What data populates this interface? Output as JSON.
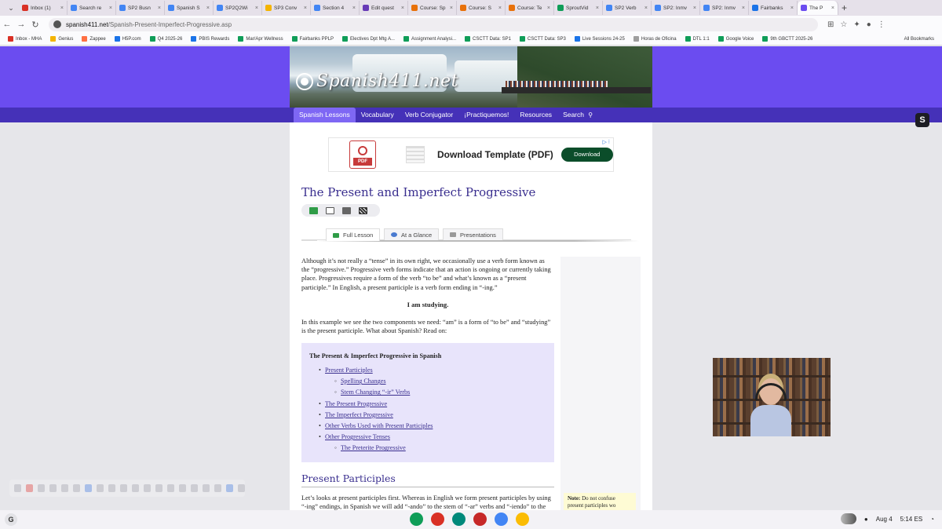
{
  "browser": {
    "tabs": [
      {
        "label": "Inbox (1)",
        "color": "#d93025"
      },
      {
        "label": "Search re",
        "color": "#4285f4"
      },
      {
        "label": "SP2 Busn",
        "color": "#4285f4"
      },
      {
        "label": "Spanish S",
        "color": "#4285f4"
      },
      {
        "label": "SP2Q2Wi",
        "color": "#4285f4"
      },
      {
        "label": "SP3 Conv",
        "color": "#f4b400"
      },
      {
        "label": "Section 4",
        "color": "#4285f4"
      },
      {
        "label": "Edit quest",
        "color": "#673ab7"
      },
      {
        "label": "Course: Sp",
        "color": "#e8710a"
      },
      {
        "label": "Course: S",
        "color": "#e8710a"
      },
      {
        "label": "Course: Te",
        "color": "#e8710a"
      },
      {
        "label": "SproutVid",
        "color": "#0f9d58"
      },
      {
        "label": "SP2 Verb",
        "color": "#4285f4"
      },
      {
        "label": "SP2: Inmv",
        "color": "#4285f4"
      },
      {
        "label": "SP2: Inmv",
        "color": "#4285f4"
      },
      {
        "label": "Fairbanks",
        "color": "#1a73e8"
      },
      {
        "label": "The P",
        "color": "#6b4cf0",
        "active": true
      }
    ],
    "url_host": "spanish411.net",
    "url_path": "/Spanish-Present-Imperfect-Progressive.asp",
    "bookmarks": [
      {
        "label": "Inbox - MHA",
        "color": "#d93025"
      },
      {
        "label": "Genius",
        "color": "#f4b400"
      },
      {
        "label": "Zappee",
        "color": "#ff7043"
      },
      {
        "label": "H5P.com",
        "color": "#1a73e8"
      },
      {
        "label": "Q4 2025-26",
        "color": "#0f9d58"
      },
      {
        "label": "PBIS Rewards",
        "color": "#1a73e8"
      },
      {
        "label": "Mar/Apr Wellness",
        "color": "#0f9d58"
      },
      {
        "label": "Fairbanks PPLP",
        "color": "#0f9d58"
      },
      {
        "label": "Electives Dpt Mtg A...",
        "color": "#0f9d58"
      },
      {
        "label": "Assignment Analysi...",
        "color": "#0f9d58"
      },
      {
        "label": "CSCTT Data: SP1",
        "color": "#0f9d58"
      },
      {
        "label": "CSCTT Data: SP3",
        "color": "#0f9d58"
      },
      {
        "label": "Live Sessions 24-25",
        "color": "#1a73e8"
      },
      {
        "label": "Horas de Oficina",
        "color": "#9e9e9e"
      },
      {
        "label": "DTL 1:1",
        "color": "#0f9d58"
      },
      {
        "label": "Google Voice",
        "color": "#0f9d58"
      },
      {
        "label": "9th GBCTT 2025-26",
        "color": "#0f9d58"
      }
    ],
    "all_bookmarks": "All Bookmarks"
  },
  "site": {
    "logo": "Spanish411.net",
    "nav": [
      {
        "label": "Spanish Lessons",
        "active": true
      },
      {
        "label": "Vocabulary"
      },
      {
        "label": "Verb Conjugator"
      },
      {
        "label": "¡Practiquemos!"
      },
      {
        "label": "Resources"
      },
      {
        "label": "Search"
      }
    ]
  },
  "ad": {
    "title": "Download Template (PDF)",
    "button": "Download",
    "pdf_label": "PDF"
  },
  "lesson": {
    "title": "The Present and Imperfect Progressive",
    "tabs": [
      {
        "label": "Full Lesson",
        "active": true
      },
      {
        "label": "At a Glance"
      },
      {
        "label": "Presentations"
      }
    ],
    "intro": "Although it’s not really a “tense” in its own right, we occasionally use a verb form known as the “progressive.” Progressive verb forms indicate that an action is ongoing or currently taking place. Progressives require a form of the verb “to be” and what’s known as a “present participle.” In English, a present participle is a verb form ending in “-ing.”",
    "example": "I am studying.",
    "explanation": "In this example we see the two components we need: “am” is a form of “to be” and “studying” is the present participle. What about Spanish? Read on:",
    "toc_title": "The Present & Imperfect Progressive in Spanish",
    "toc": [
      {
        "label": "Present Participles",
        "level": 1
      },
      {
        "label": "Spelling Changes",
        "level": 2
      },
      {
        "label": "Stem Changing “-ir” Verbs",
        "level": 2
      },
      {
        "label": "The Present Progressive",
        "level": 1
      },
      {
        "label": "The Imperfect Progressive",
        "level": 1
      },
      {
        "label": "Other Verbs Used with Present Participles",
        "level": 1
      },
      {
        "label": "Other Progressive Tenses",
        "level": 1
      },
      {
        "label": "The Preterite Progressive",
        "level": 2
      }
    ],
    "section_heading": "Present Participles",
    "section_text": "Let’s looks at present participles first. Whereas in English we form present participles by using “-ing” endings, in Spanish we will add “-ando” to the stem of “-ar” verbs and “-iendo” to the",
    "note_label": "Note:",
    "note_text": " Do not confuse present participles wo"
  },
  "extension": {
    "label": "S"
  },
  "taskbar": {
    "launcher": "G",
    "apps": [
      {
        "color": "#0f9d58"
      },
      {
        "color": "#d93025"
      },
      {
        "color": "#00897b"
      },
      {
        "color": "#c62828"
      },
      {
        "color": "#4285f4"
      },
      {
        "color": "#fbbc04"
      }
    ],
    "date": "Aug 4",
    "time": "5:14",
    "locale": "ES"
  }
}
